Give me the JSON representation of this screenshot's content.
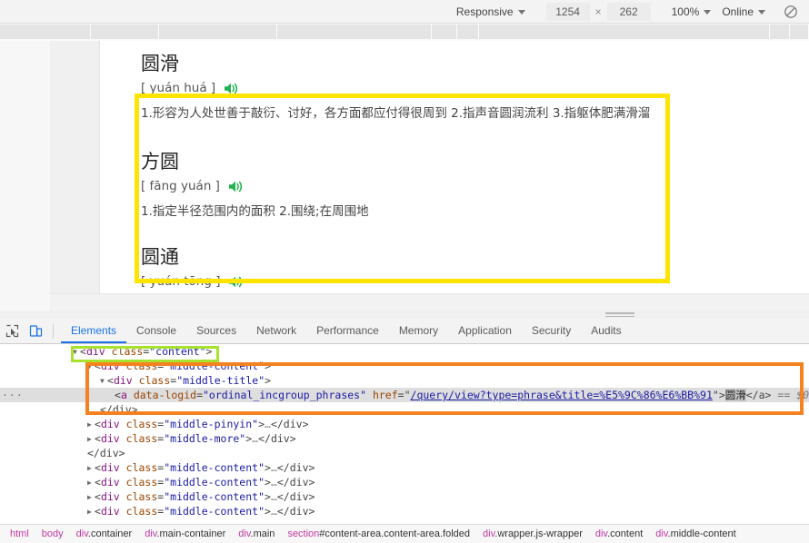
{
  "device_toolbar": {
    "device_preset": "Responsive",
    "width": "1254",
    "x_symbol": "×",
    "height": "262",
    "zoom": "100%",
    "throttling": "Online",
    "no_entry_icon": "no-throttle-icon"
  },
  "page": {
    "entries": [
      {
        "title": "圆滑",
        "pinyin": "[ yuán huá ]",
        "speaker_icon": "speaker-icon",
        "definition": "1.形容为人处世善于敲衍、讨好，各方面都应付得很周到 2.指声音圆润流利 3.指躯体肥满滑溜"
      },
      {
        "title": "方圆",
        "pinyin": "[ fāng yuán ]",
        "speaker_icon": "speaker-icon",
        "definition": "1.指定半径范围内的面积 2.围绕;在周围地"
      },
      {
        "title": "圆通",
        "pinyin": "[ yuán tōng ]",
        "speaker_icon": "speaker-icon",
        "definition": ""
      }
    ]
  },
  "devtools": {
    "inspect_icon": "inspect-element-icon",
    "device_toggle_icon": "device-toolbar-icon",
    "tabs": [
      {
        "label": "Elements",
        "active": true
      },
      {
        "label": "Console",
        "active": false
      },
      {
        "label": "Sources",
        "active": false
      },
      {
        "label": "Network",
        "active": false
      },
      {
        "label": "Performance",
        "active": false
      },
      {
        "label": "Memory",
        "active": false
      },
      {
        "label": "Application",
        "active": false
      },
      {
        "label": "Security",
        "active": false
      },
      {
        "label": "Audits",
        "active": false
      }
    ],
    "dom": {
      "highlight_green": "div.content",
      "highlight_orange": "div.middle-title",
      "gutter_marker": "···",
      "lines": {
        "l1_tag": "div",
        "l1_attr": "class",
        "l1_val": "\"content\"",
        "l2_val": "\"middle-content\"",
        "l3_val": "\"middle-title\"",
        "anchor_tag": "a",
        "anchor_attr1": "data-logid",
        "anchor_val1": "\"ordinal_incgroup_phrases\"",
        "anchor_attr2": "href",
        "anchor_href": "/query/view?type=phrase&title=%E5%9C%86%E6%BB%91",
        "anchor_text": "圆滑",
        "anchor_close": "</a>",
        "anchor_ref": "== $0",
        "close_div": "</div>",
        "pinyin_val": "\"middle-pinyin\"",
        "more_val": "\"middle-more\"",
        "content_val": "\"middle-content\"",
        "ellipsis": "…"
      }
    },
    "breadcrumb": [
      {
        "name": "html",
        "cls": ""
      },
      {
        "name": "body",
        "cls": ""
      },
      {
        "name": "div",
        "cls": ".container"
      },
      {
        "name": "div",
        "cls": ".main-container"
      },
      {
        "name": "div",
        "cls": ".main"
      },
      {
        "name": "section",
        "cls": "#content-area.content-area.folded"
      },
      {
        "name": "div",
        "cls": ".wrapper.js-wrapper"
      },
      {
        "name": "div",
        "cls": ".content"
      },
      {
        "name": "div",
        "cls": ".middle-content"
      }
    ]
  },
  "colors": {
    "accent_blue": "#1a73e8",
    "highlight_yellow": "#ffe400",
    "highlight_green": "#a6e22e",
    "highlight_orange": "#f58220",
    "speaker_green": "#21b34f",
    "tag_purple": "#881280",
    "attr_orange": "#994500",
    "value_blue": "#1a1aa6"
  }
}
